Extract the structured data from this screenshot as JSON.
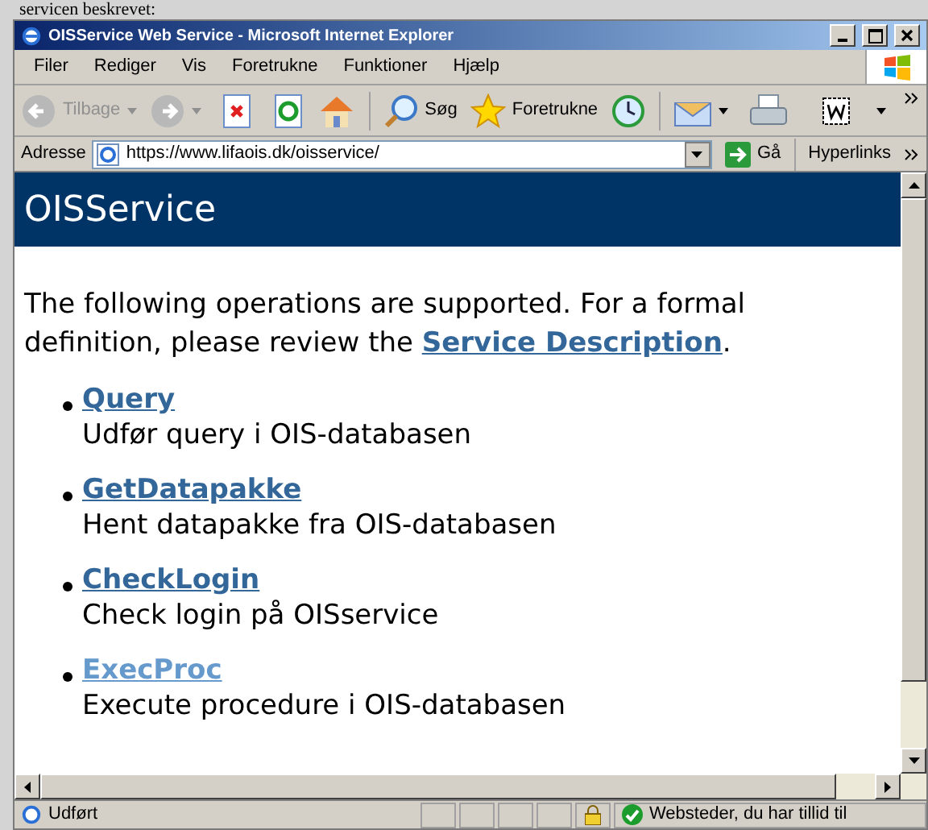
{
  "background_text": "servicen beskrevet:",
  "window": {
    "title": "OISService Web Service - Microsoft Internet Explorer"
  },
  "menu": [
    "Filer",
    "Rediger",
    "Vis",
    "Foretrukne",
    "Funktioner",
    "Hjælp"
  ],
  "toolbar": {
    "back": "Tilbage",
    "search": "Søg",
    "favorites": "Foretrukne"
  },
  "address_bar": {
    "label": "Adresse",
    "value": "https://www.lifaois.dk/oisservice/",
    "go": "Gå",
    "links": "Hyperlinks"
  },
  "page": {
    "heading": "OISService",
    "intro": "The following operations are supported. For a formal definition, please review the ",
    "intro_link": "Service Description",
    "intro_end": ".",
    "operations": [
      {
        "name": "Query",
        "description": "Udfør query i OIS-databasen",
        "visited": false
      },
      {
        "name": "GetDatapakke",
        "description": "Hent datapakke fra OIS-databasen",
        "visited": false
      },
      {
        "name": "CheckLogin",
        "description": "Check login på OISservice",
        "visited": false
      },
      {
        "name": "ExecProc",
        "description": "Execute procedure i OIS-databasen",
        "visited": true
      }
    ]
  },
  "status_bar": {
    "status": "Udført",
    "zone": "Websteder, du har tillid til"
  }
}
